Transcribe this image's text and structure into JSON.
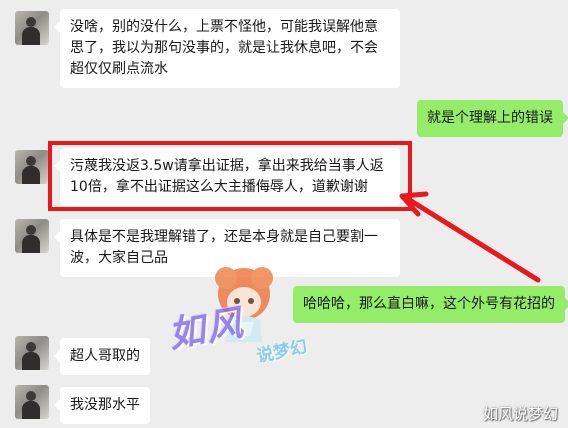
{
  "messages": [
    {
      "side": "left",
      "text": "没啥，别的没什么，上票不怪他，可能我误解他意思了，我以为那句没事的，就是让我休息吧，不会超仅仅刷点流水"
    },
    {
      "side": "right",
      "text": "就是个理解上的错误"
    },
    {
      "side": "left",
      "text": "污蔑我没返3.5w请拿出证据，拿出来我给当事人返10倍，拿不出证据这么大主播侮辱人，道歉谢谢"
    },
    {
      "side": "left",
      "text": "具体是不是我理解错了，还是本身就是自己要割一波，大家自己品"
    },
    {
      "side": "right",
      "text": "哈哈哈，那么直白嘛，这个外号有花招的"
    },
    {
      "side": "left",
      "text": "超人哥取的"
    },
    {
      "side": "left",
      "text": "我没那水平"
    }
  ],
  "watermark": {
    "logo": "如风",
    "sub": "说梦幻",
    "corner": "如风说梦幻"
  },
  "colors": {
    "highlight": "#e8191d",
    "right_bubble": "#95ec69",
    "background": "#ededed"
  }
}
